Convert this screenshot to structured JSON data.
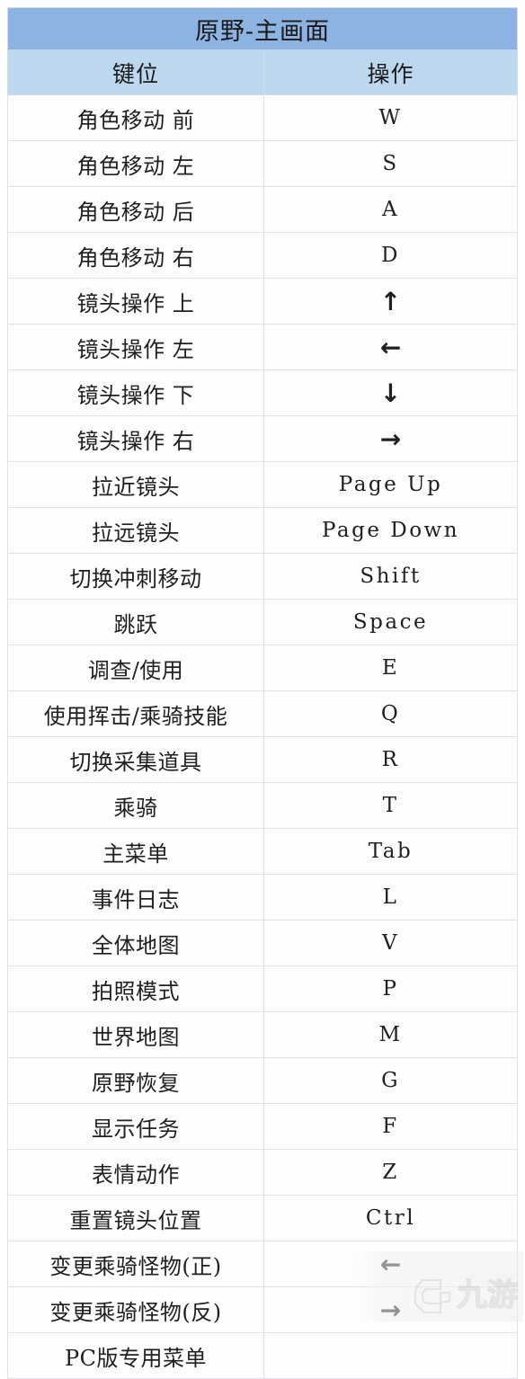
{
  "document": {
    "title": "原野-主画面",
    "colors": {
      "title_bg": "#8db3e2",
      "header_bg": "#bdd7ee",
      "grid_line": "#dde3e8",
      "text": "#202020"
    }
  },
  "table": {
    "headers": {
      "action": "键位",
      "key": "操作"
    },
    "rows": [
      {
        "action": "角色移动 前",
        "key": "W",
        "is_arrow": false
      },
      {
        "action": "角色移动 左",
        "key": "S",
        "is_arrow": false
      },
      {
        "action": "角色移动 后",
        "key": "A",
        "is_arrow": false
      },
      {
        "action": "角色移动 右",
        "key": "D",
        "is_arrow": false
      },
      {
        "action": "镜头操作 上",
        "key": "↑",
        "is_arrow": true
      },
      {
        "action": "镜头操作 左",
        "key": "←",
        "is_arrow": true
      },
      {
        "action": "镜头操作 下",
        "key": "↓",
        "is_arrow": true
      },
      {
        "action": "镜头操作 右",
        "key": "→",
        "is_arrow": true
      },
      {
        "action": "拉近镜头",
        "key": "Page Up",
        "is_arrow": false
      },
      {
        "action": "拉远镜头",
        "key": "Page Down",
        "is_arrow": false
      },
      {
        "action": "切换冲刺移动",
        "key": "Shift",
        "is_arrow": false
      },
      {
        "action": "跳跃",
        "key": "Space",
        "is_arrow": false
      },
      {
        "action": "调查/使用",
        "key": "E",
        "is_arrow": false
      },
      {
        "action": "使用挥击/乘骑技能",
        "key": "Q",
        "is_arrow": false
      },
      {
        "action": "切换采集道具",
        "key": "R",
        "is_arrow": false
      },
      {
        "action": "乘骑",
        "key": "T",
        "is_arrow": false
      },
      {
        "action": "主菜单",
        "key": "Tab",
        "is_arrow": false
      },
      {
        "action": "事件日志",
        "key": "L",
        "is_arrow": false
      },
      {
        "action": "全体地图",
        "key": "V",
        "is_arrow": false
      },
      {
        "action": "拍照模式",
        "key": "P",
        "is_arrow": false
      },
      {
        "action": "世界地图",
        "key": "M",
        "is_arrow": false
      },
      {
        "action": "原野恢复",
        "key": "G",
        "is_arrow": false
      },
      {
        "action": "显示任务",
        "key": "F",
        "is_arrow": false
      },
      {
        "action": "表情动作",
        "key": "Z",
        "is_arrow": false
      },
      {
        "action": "重置镜头位置",
        "key": "Ctrl",
        "is_arrow": false
      },
      {
        "action": "变更乘骑怪物(正)",
        "key": "←",
        "is_arrow": true
      },
      {
        "action": "变更乘骑怪物(反)",
        "key": "→",
        "is_arrow": true
      },
      {
        "action": "PC版专用菜单",
        "key": "",
        "is_arrow": false
      }
    ]
  },
  "watermark": {
    "text": "九游"
  }
}
